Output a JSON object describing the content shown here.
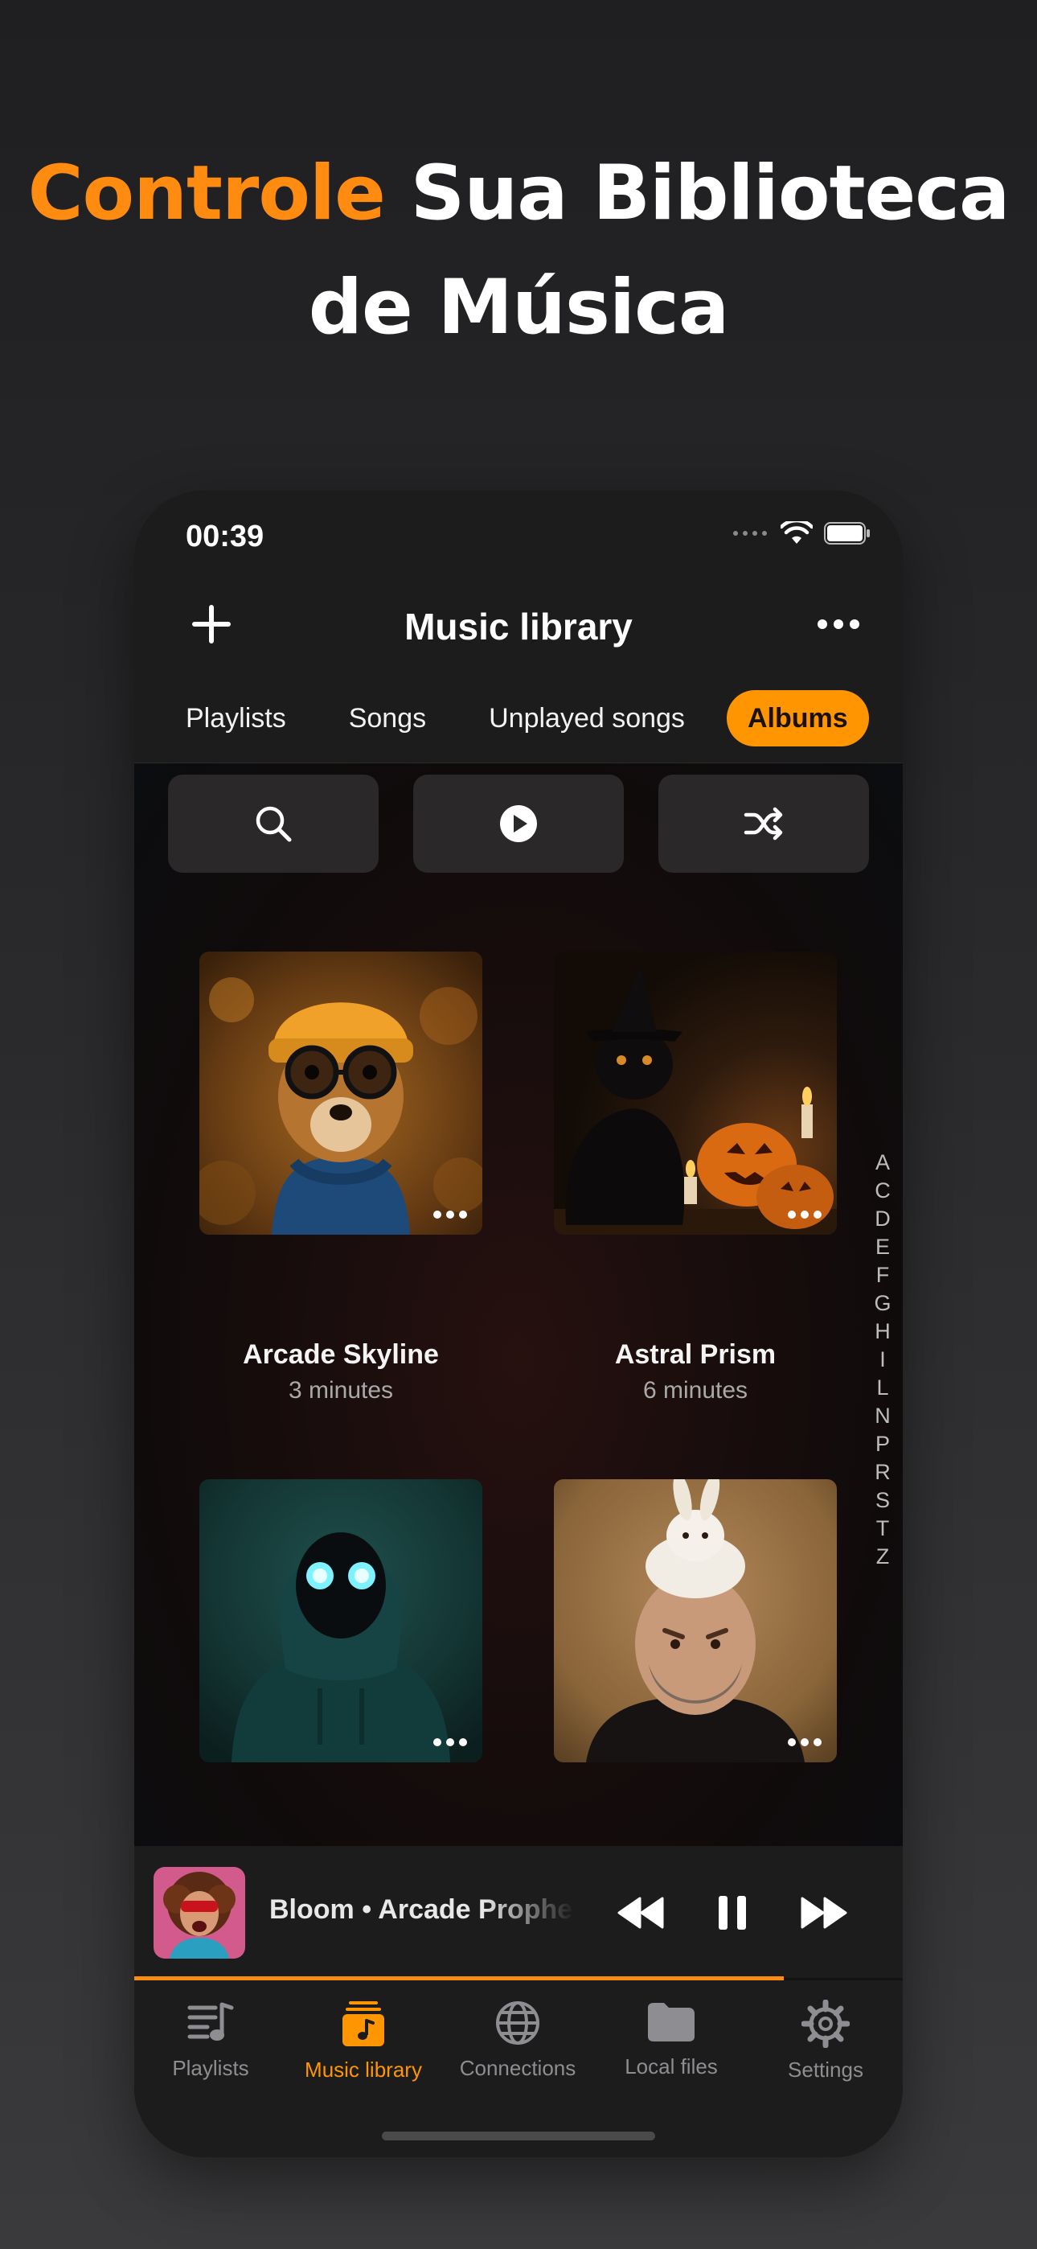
{
  "headline": {
    "accent": "Controle",
    "line1_rest": " Sua Biblioteca",
    "line2": "de Música"
  },
  "status": {
    "time": "00:39"
  },
  "nav": {
    "title": "Music library"
  },
  "tabs": [
    {
      "label": "Playlists",
      "active": false
    },
    {
      "label": "Songs",
      "active": false
    },
    {
      "label": "Unplayed songs",
      "active": false
    },
    {
      "label": "Albums",
      "active": true
    }
  ],
  "actions": {
    "search": "search-icon",
    "play": "play-icon",
    "shuffle": "shuffle-icon"
  },
  "albums": [
    {
      "title": "Arcade Skyline",
      "subtitle": "3 minutes"
    },
    {
      "title": "Astral Prism",
      "subtitle": "6 minutes"
    },
    {
      "title": "",
      "subtitle": ""
    },
    {
      "title": "",
      "subtitle": ""
    }
  ],
  "index_letters": [
    "A",
    "C",
    "D",
    "E",
    "F",
    "G",
    "H",
    "I",
    "L",
    "N",
    "P",
    "R",
    "S",
    "T",
    "Z"
  ],
  "player": {
    "now_playing": "Bloom • Arcade Prophets",
    "progress": 0.845,
    "state": "playing"
  },
  "tabbar": [
    {
      "label": "Playlists",
      "icon": "playlists-icon",
      "active": false
    },
    {
      "label": "Music library",
      "icon": "music-library-icon",
      "active": true
    },
    {
      "label": "Connections",
      "icon": "globe-icon",
      "active": false
    },
    {
      "label": "Local files",
      "icon": "folder-icon",
      "active": false
    },
    {
      "label": "Settings",
      "icon": "gear-icon",
      "active": false
    }
  ],
  "colors": {
    "accent": "#ff9500",
    "headline_accent": "#ff8c10",
    "background": "#1f1f21"
  }
}
